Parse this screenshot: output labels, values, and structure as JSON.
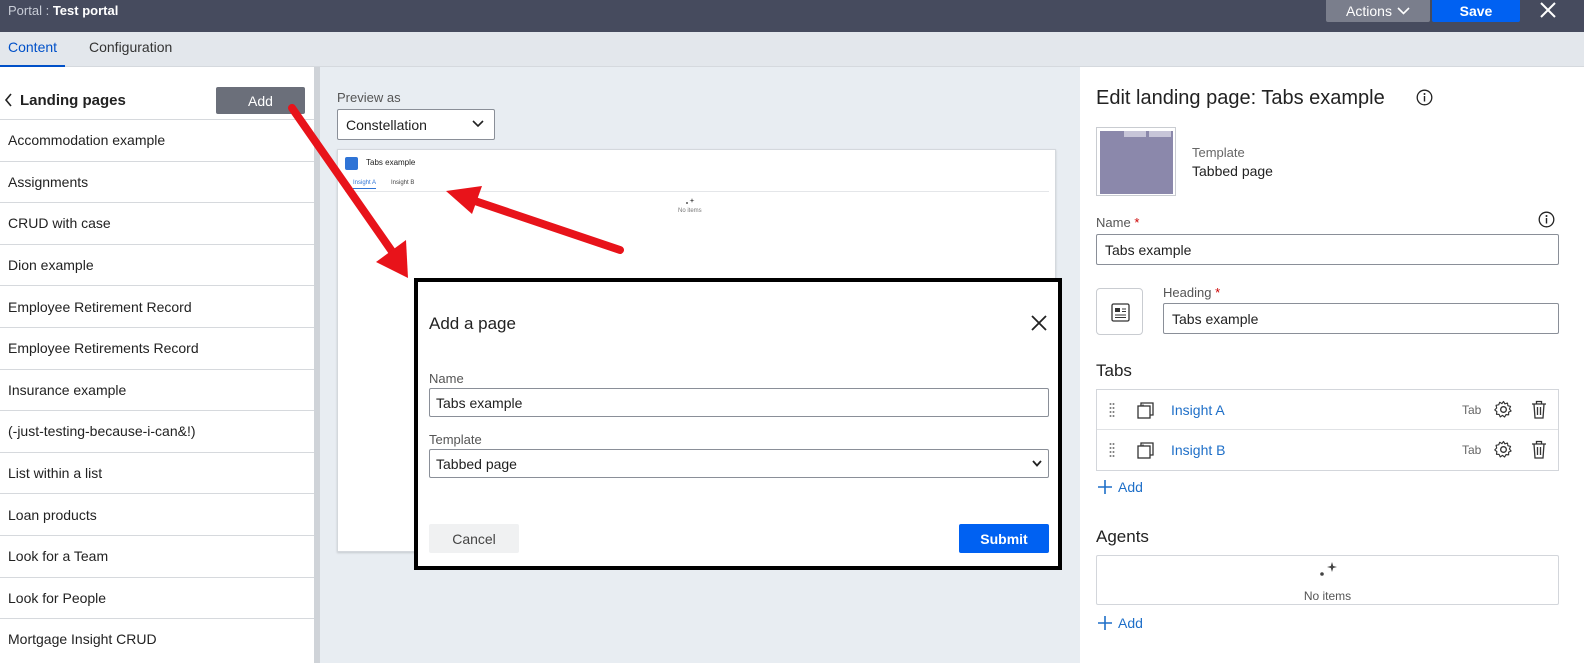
{
  "topbar": {
    "portal_label": "Portal",
    "portal_sep": " : ",
    "portal_name": "Test portal",
    "actions_label": "Actions",
    "save_label": "Save"
  },
  "tabs": [
    {
      "label": "Content",
      "active": true
    },
    {
      "label": "Configuration",
      "active": false
    }
  ],
  "left_panel": {
    "title": "Landing pages",
    "add_label": "Add",
    "items": [
      "Accommodation example",
      "Assignments",
      "CRUD with case",
      "Dion example",
      "Employee Retirement Record",
      "Employee Retirements Record",
      "Insurance example",
      "(-just-testing-because-i-can&!)",
      "List within a list",
      "Loan products",
      "Look for a Team",
      "Look for People",
      "Mortgage Insight CRUD"
    ]
  },
  "preview": {
    "label": "Preview as",
    "selected": "Constellation",
    "card_title": "Tabs example",
    "card_tabs": [
      "Insight A",
      "Insight B"
    ],
    "empty_text": "No items"
  },
  "modal": {
    "title": "Add a page",
    "name_label": "Name",
    "name_value": "Tabs example",
    "template_label": "Template",
    "template_value": "Tabbed page",
    "cancel_label": "Cancel",
    "submit_label": "Submit"
  },
  "right_panel": {
    "title": "Edit landing page: Tabs example",
    "template_label": "Template",
    "template_value": "Tabbed page",
    "name_label": "Name",
    "name_value": "Tabs example",
    "heading_label": "Heading",
    "heading_value": "Tabs example",
    "required_mark": "*",
    "tabs_section": "Tabs",
    "tab_items": [
      {
        "label": "Insight A",
        "kind": "Tab"
      },
      {
        "label": "Insight B",
        "kind": "Tab"
      }
    ],
    "add_label": "Add",
    "agents_section": "Agents",
    "agents_empty": "No items"
  },
  "colors": {
    "topbar": "#464b5e",
    "primary": "#0061f2",
    "link": "#1e6fc8",
    "annotation": "#e8131a"
  }
}
